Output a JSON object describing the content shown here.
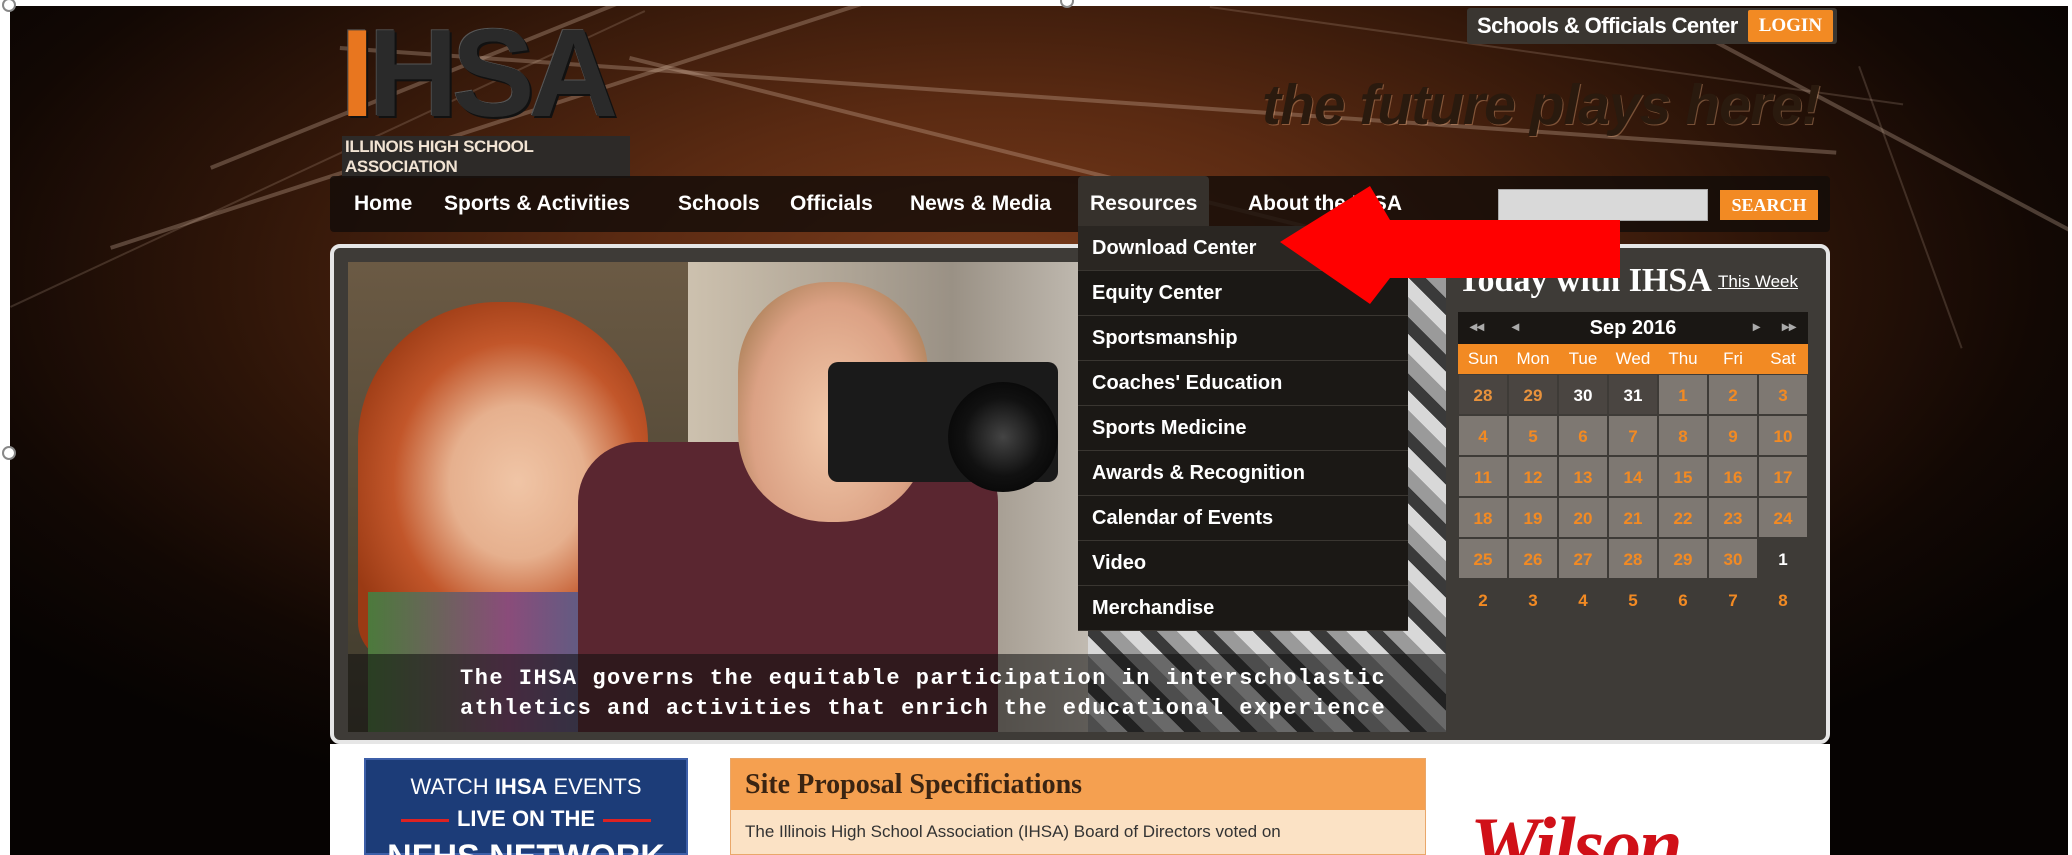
{
  "logo": {
    "mark_left": "I",
    "mark_right": "HSA",
    "subtitle": "ILLINOIS HIGH SCHOOL ASSOCIATION"
  },
  "header": {
    "center_label": "Schools & Officials Center",
    "login_label": "LOGIN",
    "tagline": "the future plays here!"
  },
  "nav": {
    "items": [
      "Home",
      "Sports & Activities",
      "Schools",
      "Officials",
      "News & Media",
      "Resources",
      "About the IHSA"
    ],
    "search_placeholder": "",
    "search_label": "SEARCH"
  },
  "dropdown": {
    "items": [
      "Download Center",
      "Equity Center",
      "Sportsmanship",
      "Coaches' Education",
      "Sports Medicine",
      "Awards & Recognition",
      "Calendar of Events",
      "Video",
      "Merchandise"
    ]
  },
  "hero": {
    "caption_line1": "The IHSA governs the equitable participation in interscholastic",
    "caption_line2": "athletics and activities that enrich the educational experience"
  },
  "calendar": {
    "title": "Today with IHSA",
    "this_week": "This Week",
    "month": "Sep 2016",
    "prev_year": "◂◂",
    "prev": "◂",
    "next": "▸",
    "next_year": "▸▸",
    "dow": [
      "Sun",
      "Mon",
      "Tue",
      "Wed",
      "Thu",
      "Fri",
      "Sat"
    ],
    "weeks": [
      [
        "28",
        "29",
        "30",
        "31",
        "1",
        "2",
        "3"
      ],
      [
        "4",
        "5",
        "6",
        "7",
        "8",
        "9",
        "10"
      ],
      [
        "11",
        "12",
        "13",
        "14",
        "15",
        "16",
        "17"
      ],
      [
        "18",
        "19",
        "20",
        "21",
        "22",
        "23",
        "24"
      ],
      [
        "25",
        "26",
        "27",
        "28",
        "29",
        "30",
        "1"
      ],
      [
        "2",
        "3",
        "4",
        "5",
        "6",
        "7",
        "8"
      ]
    ]
  },
  "lower": {
    "watch_l1_a": "WATCH ",
    "watch_l1_b": "IHSA",
    "watch_l1_c": " EVENTS",
    "watch_l2": "LIVE ON THE",
    "watch_l3": "NFHS NETWORK",
    "proposal_title": "Site Proposal Specificiations",
    "proposal_body": "The Illinois High School Association (IHSA) Board of Directors voted on",
    "sponsor": "Wilson"
  },
  "colors": {
    "accent": "#f28a23",
    "arrow": "#ff0000",
    "sponsor": "#d01018"
  }
}
